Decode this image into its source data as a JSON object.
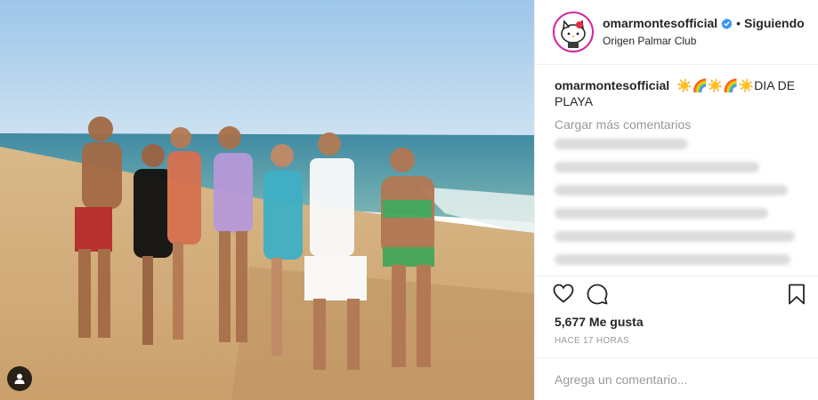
{
  "header": {
    "username": "omarmontesofficial",
    "follow_status": "Siguiendo",
    "separator": "•",
    "location": "Origen Palmar Club"
  },
  "caption": {
    "username": "omarmontesofficial",
    "text": "☀️🌈☀️🌈☀️DIA DE PLAYA"
  },
  "comments": {
    "load_more": "Cargar más comentarios"
  },
  "likes": {
    "text": "5,677 Me gusta"
  },
  "timestamp": "HACE 17 HORAS",
  "add_comment": {
    "placeholder": "Agrega un comentario..."
  },
  "colors": {
    "verified": "#3897f0",
    "avatar_ring": "#d6249f",
    "muted": "#999999"
  },
  "icons": [
    "user-tag-icon",
    "verified-icon",
    "heart-icon",
    "comment-icon",
    "bookmark-icon"
  ]
}
